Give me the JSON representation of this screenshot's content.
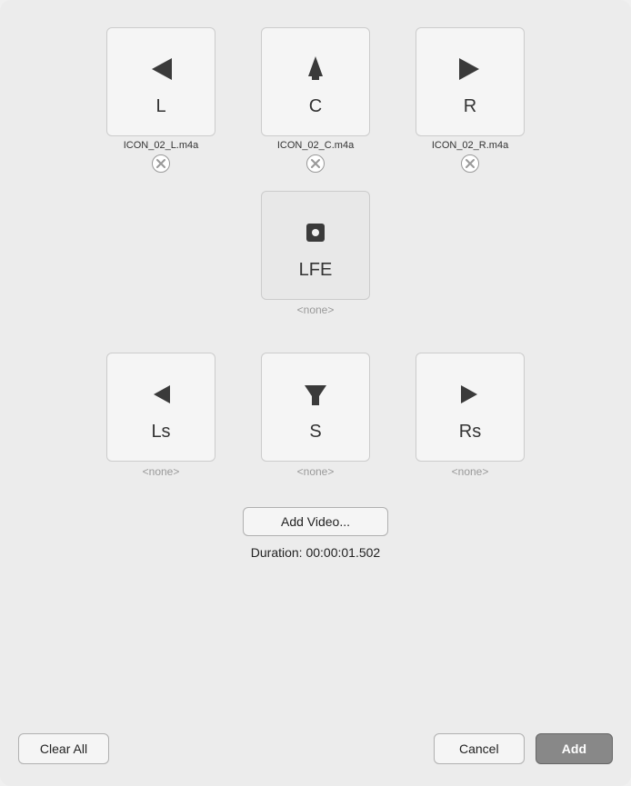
{
  "channels": {
    "row1": [
      {
        "id": "L",
        "label": "L",
        "filename": "ICON_02_L.m4a",
        "hasFile": true,
        "iconType": "arrow-left"
      },
      {
        "id": "C",
        "label": "C",
        "filename": "ICON_02_C.m4a",
        "hasFile": true,
        "iconType": "speaker"
      },
      {
        "id": "R",
        "label": "R",
        "filename": "ICON_02_R.m4a",
        "hasFile": true,
        "iconType": "arrow-right"
      }
    ],
    "row2": [
      {
        "id": "LFE",
        "label": "LFE",
        "filename": "",
        "hasFile": false,
        "iconType": "lfe"
      }
    ],
    "row3": [
      {
        "id": "Ls",
        "label": "Ls",
        "filename": "",
        "hasFile": false,
        "iconType": "arrow-left-rear"
      },
      {
        "id": "S",
        "label": "S",
        "filename": "",
        "hasFile": false,
        "iconType": "funnel"
      },
      {
        "id": "Rs",
        "label": "Rs",
        "filename": "",
        "hasFile": false,
        "iconType": "arrow-right-rear"
      }
    ]
  },
  "none_label": "<none>",
  "add_video_label": "Add Video...",
  "duration_label": "Duration: 00:00:01.502",
  "clear_all_label": "Clear All",
  "cancel_label": "Cancel",
  "add_label": "Add"
}
